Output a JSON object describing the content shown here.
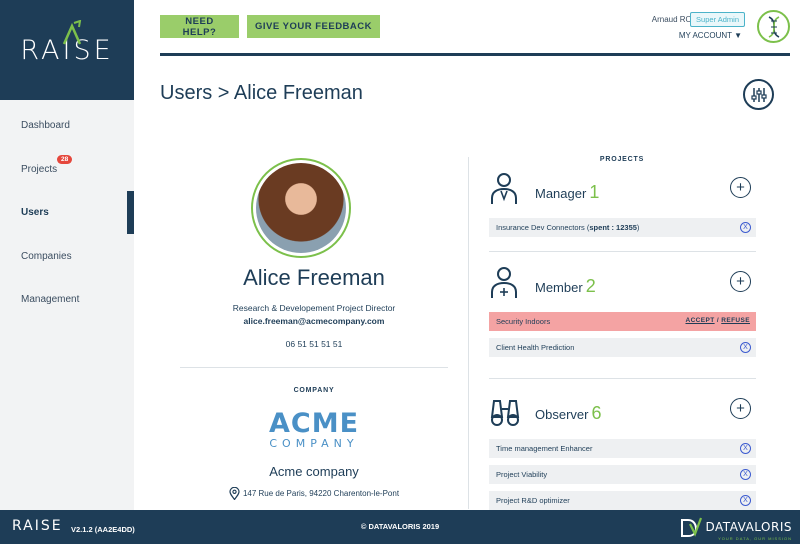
{
  "brand": {
    "logo": "RAISE"
  },
  "sidebar": {
    "items": [
      {
        "label": "Dashboard"
      },
      {
        "label": "Projects",
        "badge": "28"
      },
      {
        "label": "Users",
        "active": true
      },
      {
        "label": "Companies"
      },
      {
        "label": "Management"
      }
    ]
  },
  "header": {
    "help_label": "NEED HELP?",
    "feedback_label": "GIVE YOUR FEEDBACK",
    "user_name": "Arnaud ROESCH",
    "role": "Super Admin",
    "account_label": "MY ACCOUNT ▼"
  },
  "page": {
    "title": "Users > Alice Freeman"
  },
  "profile": {
    "name": "Alice Freeman",
    "job": "Research & Developement Project Director",
    "email": "alice.freeman@acmecompany.com",
    "phone": "06 51 51 51 51",
    "company_label": "COMPANY",
    "company_logo_big": "ACME",
    "company_logo_small": "COMPANY",
    "company_name": "Acme company",
    "company_address": "147 Rue de Paris, 94220 Charenton-le-Pont"
  },
  "projects": {
    "title": "PROJECTS",
    "manager": {
      "label": "Manager",
      "count": "1",
      "items": [
        {
          "name": "Insurance Dev Connectors (",
          "spent_label": "spent : 12355",
          "tail": ")"
        }
      ]
    },
    "member": {
      "label": "Member",
      "count": "2",
      "pending": {
        "name": "Security Indoors",
        "accept": "ACCEPT",
        "sep": " / ",
        "refuse": "REFUSE"
      },
      "items": [
        {
          "name": "Client Health Prediction"
        }
      ]
    },
    "observer": {
      "label": "Observer",
      "count": "6",
      "items": [
        {
          "name": "Time management Enhancer"
        },
        {
          "name": "Project Viability"
        },
        {
          "name": "Project R&D optimizer"
        }
      ]
    },
    "remove_glyph": "X"
  },
  "footer": {
    "logo": "RAISE",
    "version": "V2.1.2 (AA2E4DD)",
    "copyright": "© DATAVALORIS 2019",
    "dv_name": "DATAVALORIS",
    "dv_tagline": "YOUR DATA, OUR MISSION"
  },
  "colors": {
    "navy": "#1e3d57",
    "green": "#7cc04b",
    "pending": "#f4a3a3",
    "badge": "#e5473c"
  }
}
